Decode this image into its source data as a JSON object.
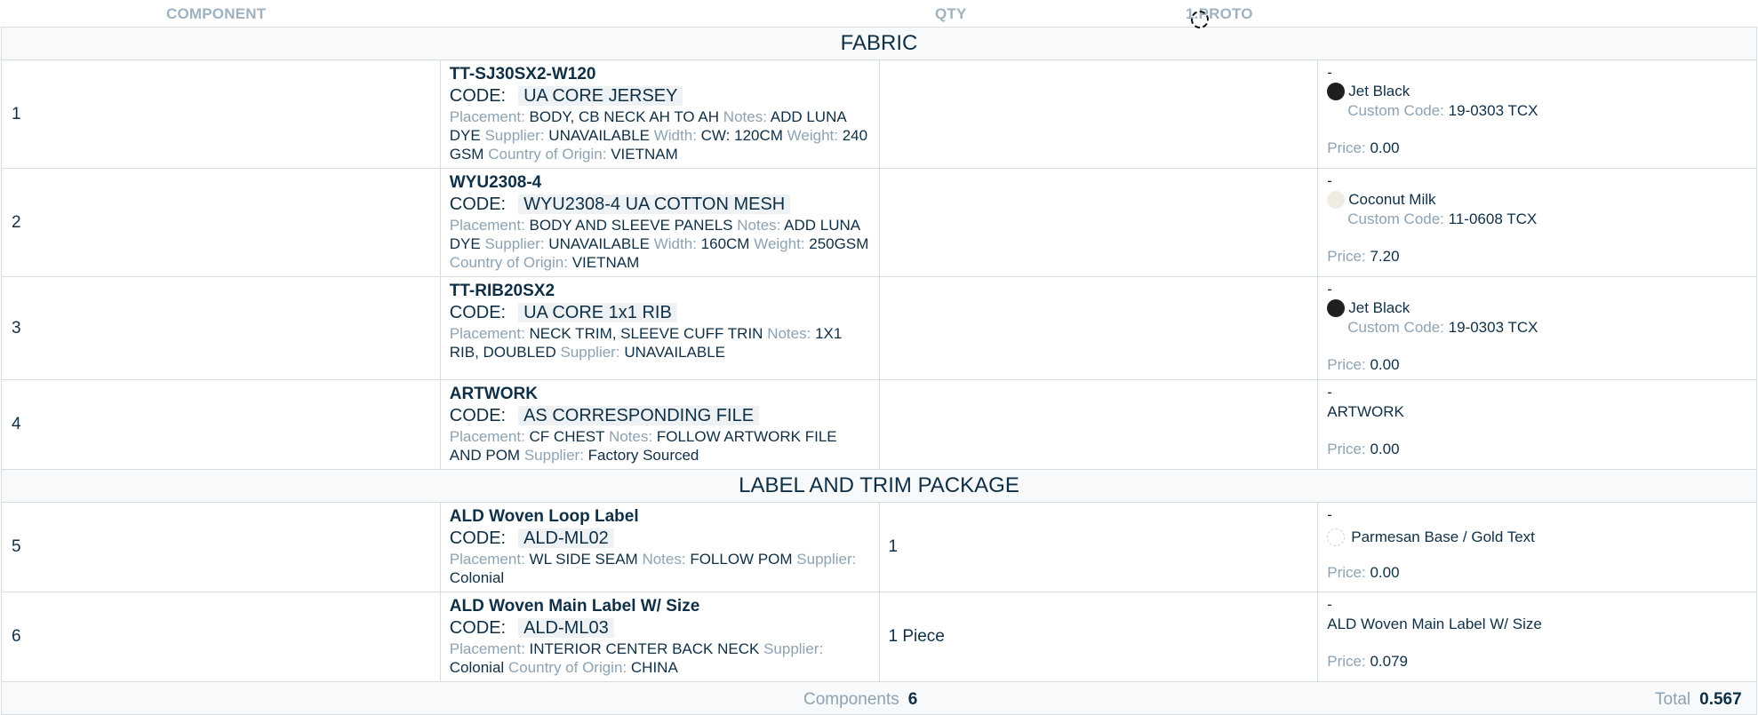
{
  "header": {
    "component": "COMPONENT",
    "qty": "QTY",
    "proto_num": "1.",
    "proto": "PROTO"
  },
  "labels": {
    "code": "CODE:",
    "placement": "Placement:",
    "notes": "Notes:",
    "supplier": "Supplier:",
    "width": "Width:",
    "weight": "Weight:",
    "country": "Country of Origin:",
    "custom_code": "Custom Code:",
    "price": "Price:"
  },
  "sections": {
    "fabric": "FABRIC",
    "label_trim": "LABEL AND TRIM PACKAGE"
  },
  "rows": [
    {
      "index": "1",
      "name": "TT-SJ30SX2-W120",
      "code": "UA CORE JERSEY",
      "placement": "BODY, CB NECK AH TO AH",
      "notes": "ADD LUNA DYE",
      "supplier": "UNAVAILABLE",
      "width": "CW: 120CM",
      "weight": "240 GSM",
      "country": "VIETNAM",
      "qty": "",
      "dash": "-",
      "color_name": "Jet Black",
      "color_hex": "#1f1f1f",
      "custom_code": "19-0303 TCX",
      "price": "0.00"
    },
    {
      "index": "2",
      "name": "WYU2308-4",
      "code": "WYU2308-4 UA COTTON MESH",
      "placement": "BODY AND SLEEVE PANELS",
      "notes": "ADD LUNA DYE",
      "supplier": "UNAVAILABLE",
      "width": "160CM",
      "weight": "250GSM",
      "country": "VIETNAM",
      "qty": "",
      "dash": "-",
      "color_name": "Coconut Milk",
      "color_hex": "#efece1",
      "custom_code": "11-0608 TCX",
      "price": "7.20"
    },
    {
      "index": "3",
      "name": "TT-RIB20SX2",
      "code": "UA CORE 1x1 RIB",
      "placement": "NECK TRIM, SLEEVE CUFF TRIN",
      "notes": "1X1 RIB, DOUBLED",
      "supplier": "UNAVAILABLE",
      "qty": "",
      "dash": "-",
      "color_name": "Jet Black",
      "color_hex": "#1f1f1f",
      "custom_code": "19-0303 TCX",
      "price": "0.00"
    },
    {
      "index": "4",
      "name": "ARTWORK",
      "code": "AS CORRESPONDING FILE",
      "placement": "CF CHEST",
      "notes": "FOLLOW ARTWORK FILE AND POM",
      "supplier": "Factory Sourced",
      "qty": "",
      "dash": "-",
      "proto_text": "ARTWORK",
      "price": "0.00"
    },
    {
      "index": "5",
      "name": "ALD Woven Loop Label",
      "code": "ALD-ML02",
      "placement": "WL SIDE SEAM",
      "notes": "FOLLOW POM",
      "supplier": "Colonial",
      "qty": "1",
      "dash": "-",
      "color_name": "Parmesan Base / Gold Text",
      "color_hex": "#ffffff",
      "price": "0.00"
    },
    {
      "index": "6",
      "name": "ALD Woven Main Label W/ Size",
      "code": "ALD-ML03",
      "placement": "INTERIOR CENTER BACK NECK",
      "supplier": "Colonial",
      "country": "CHINA",
      "qty": "1 Piece",
      "dash": "-",
      "proto_text": "ALD Woven Main Label W/ Size",
      "price": "0.079"
    }
  ],
  "footer": {
    "components_label": "Components",
    "components_count": "6",
    "total_label": "Total",
    "total_value": "0.567"
  }
}
